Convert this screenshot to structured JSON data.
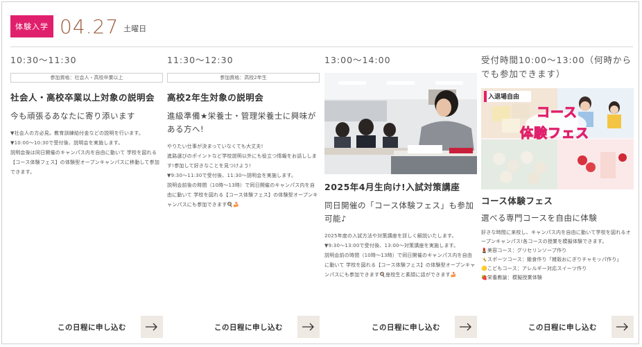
{
  "header": {
    "badge": "体験入学",
    "date": "04.27",
    "day_of_week": "土曜日"
  },
  "sessions": [
    {
      "time": "10:30〜11:30",
      "qualification": "参加資格：社会人・高校卒業以上",
      "title": "社会人・高校卒業以上対象の説明会",
      "subtitle": "今も頑張るあなたに寄り添います",
      "body": [
        "▼社会人の方必見。教育訓練給付金などの説明を行います。",
        "▼10:00〜10:30で受付後、説明会を実施します。",
        "説明会後は同日開催のキャンパス内を自由に動いて 学校を図れる【コース体験フェス】の体験型オープンキャンパスに移動して参加できます。"
      ],
      "apply_label": "この日程に申し込む"
    },
    {
      "time": "11:30〜12:30",
      "qualification": "参加資格：高校2年生",
      "title": "高校2年生対象の説明会",
      "subtitle": "進級準備★栄養士・管理栄養士に興味がある方へ!",
      "body": [
        "やりたい仕事が決まっていなくても大丈夫!",
        "進路選びのポイントなど学校説明以外にも役立つ情報をお話しします!参加して好きなことを見つけよう!",
        "▼9:30〜11:30で受付後、11:30〜説明会を実施します。",
        "説明会前後の時間（10時〜13時）で同日開催のキャンパス内を自由に動いて 学校を図れる【コース体験フェス】の体験型オープンキャンパスにも参加できます🍳🍰"
      ],
      "apply_label": "この日程に申し込む"
    },
    {
      "time": "13:00〜14:00",
      "title": "2025年4月生向け!入試対策講座",
      "subtitle": "同日開催の「コース体験フェス」も参加可能♪",
      "body": [
        "2025年度の入試方法や対策講座を詳しく解説いたします。",
        "▼9:30〜13:00で受付後、13:00〜対策講座を実施します。",
        "説明会前の時間（10時〜13時）で同日開催のキャンパス内を自由に動いて 学校を図れる【コース体験フェス】の体験型オープンキャンパスにも参加できます🍳座校生と素顔に話ができます🍰"
      ],
      "apply_label": "この日程に申し込む"
    },
    {
      "time": "受付時間10:00〜13:00（何時からでも参加できます）",
      "promo_tag": "入退場自由",
      "promo_title_1": "コース",
      "promo_title_2": "体験フェス",
      "title": "コース体験フェス",
      "subtitle": "選べる専門コースを自由に体験",
      "body": [
        "好きな時間に来校し、キャンパス内を自由に動いて学校を図れるオープンキャンパス!各コースの授業を模擬体験できます。",
        "💄美容コース：グリセリンソープ作り",
        "🤸スポーツコース：鍛食作り「雑穀おにぎりチャモッパ作り」",
        "🟡こどもコース：アレルギー対応スイーツ作り",
        "🍓栄養教諭：模擬授業体験"
      ],
      "apply_label": "この日程に申し込む"
    }
  ],
  "colors": {
    "accent": "#e0206c",
    "date": "#9a5b3d",
    "arrow_bg": "#efe9e3"
  },
  "icons": {
    "apply_arrow": "arrow-right-icon"
  }
}
